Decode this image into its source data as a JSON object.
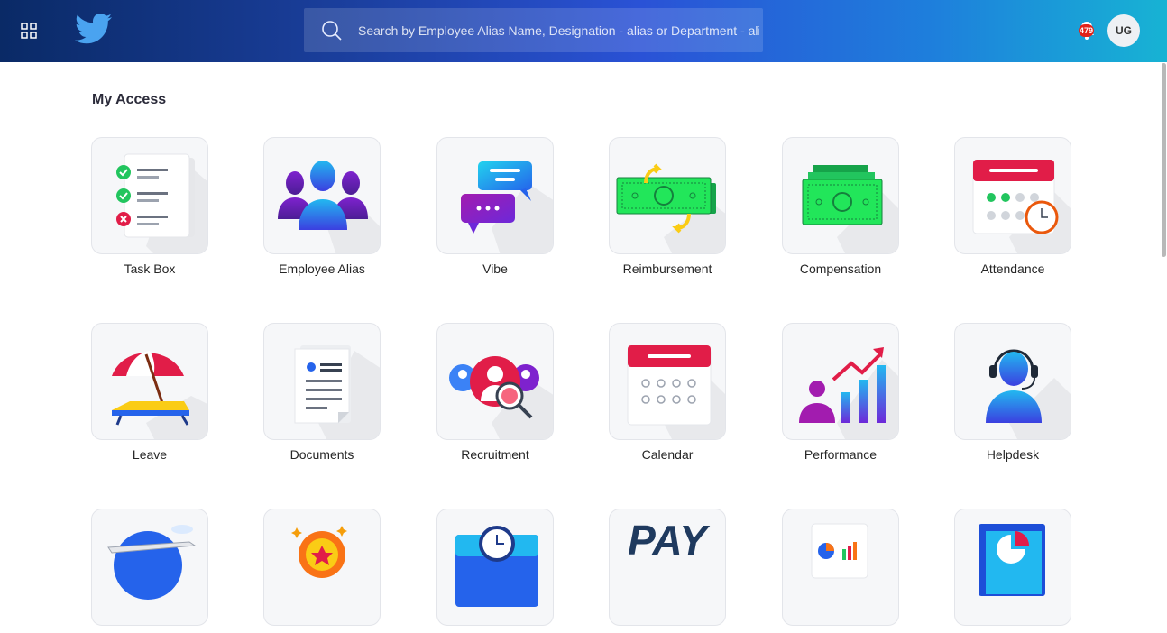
{
  "header": {
    "search_placeholder": "Search by Employee Alias Name, Designation - alias or Department - alias",
    "notification_count": "479",
    "user_initials": "UG",
    "colors": {
      "bar_start": "#0a2a66",
      "bar_end": "#17b3d4",
      "badge": "#e2231a"
    }
  },
  "main": {
    "section_title": "My Access",
    "tiles": [
      {
        "label": "Task Box",
        "icon": "task-box-icon"
      },
      {
        "label": "Employee Alias",
        "icon": "employee-alias-icon"
      },
      {
        "label": "Vibe",
        "icon": "vibe-chat-icon"
      },
      {
        "label": "Reimbursement",
        "icon": "reimbursement-icon"
      },
      {
        "label": "Compensation",
        "icon": "compensation-icon"
      },
      {
        "label": "Attendance",
        "icon": "attendance-icon"
      },
      {
        "label": "Leave",
        "icon": "leave-beach-icon"
      },
      {
        "label": "Documents",
        "icon": "documents-icon"
      },
      {
        "label": "Recruitment",
        "icon": "recruitment-icon"
      },
      {
        "label": "Calendar",
        "icon": "calendar-icon"
      },
      {
        "label": "Performance",
        "icon": "performance-icon"
      },
      {
        "label": "Helpdesk",
        "icon": "helpdesk-icon"
      },
      {
        "label": "",
        "icon": "travel-icon"
      },
      {
        "label": "",
        "icon": "rewards-icon"
      },
      {
        "label": "",
        "icon": "timesheet-icon"
      },
      {
        "label": "",
        "icon": "payroll-icon",
        "text": "PAY"
      },
      {
        "label": "",
        "icon": "reports-icon"
      },
      {
        "label": "",
        "icon": "analytics-icon"
      }
    ]
  }
}
